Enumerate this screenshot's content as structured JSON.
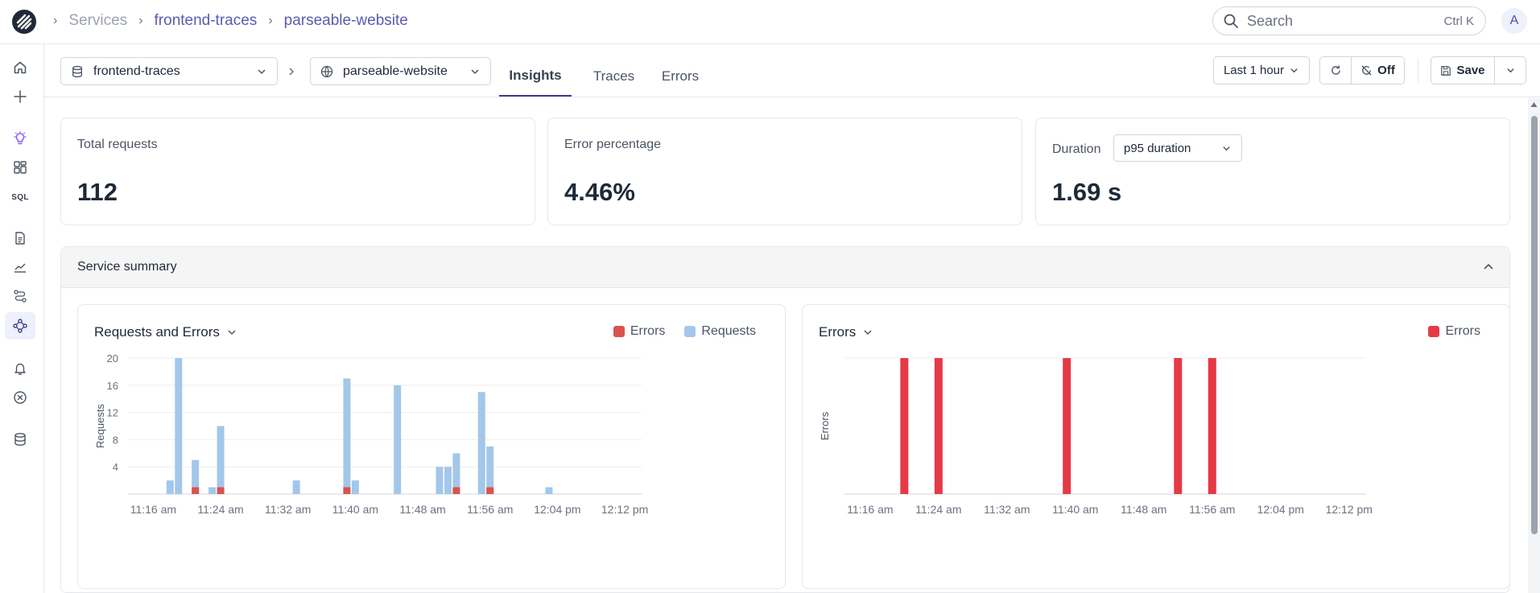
{
  "app": {
    "brand_color": "#3e3f8e",
    "avatar_initial": "A"
  },
  "breadcrumb": {
    "root": "Services",
    "stream": "frontend-traces",
    "service": "parseable-website"
  },
  "search": {
    "placeholder": "Search",
    "shortcut": "Ctrl K"
  },
  "sidebar": {
    "items": [
      {
        "icon": "home-icon"
      },
      {
        "icon": "plus-icon"
      },
      {
        "icon": "lightbulb-icon"
      },
      {
        "icon": "dashboard-icon"
      },
      {
        "icon": "sql-icon",
        "label": "SQL"
      },
      {
        "icon": "document-icon"
      },
      {
        "icon": "chart-line-icon"
      },
      {
        "icon": "flow-icon"
      },
      {
        "icon": "service-map-icon",
        "active": true
      },
      {
        "icon": "bell-icon"
      },
      {
        "icon": "close-circle-icon"
      },
      {
        "icon": "database-icon"
      }
    ]
  },
  "toolbar": {
    "stream_select": "frontend-traces",
    "service_select": "parseable-website",
    "tabs": [
      "Insights",
      "Traces",
      "Errors"
    ],
    "active_tab": "Insights",
    "time_range": "Last 1 hour",
    "auto_refresh": "Off",
    "save_label": "Save"
  },
  "cards": {
    "total_requests": {
      "label": "Total requests",
      "value": "112"
    },
    "error_percentage": {
      "label": "Error percentage",
      "value": "4.46%"
    },
    "duration": {
      "label": "Duration",
      "select": "p95 duration",
      "value": "1.69 s"
    }
  },
  "summary": {
    "title": "Service summary"
  },
  "colors": {
    "requests": "#a3c7ea",
    "errors": "#d9534f",
    "errors_bright": "#e63946"
  },
  "chart_data": [
    {
      "type": "bar",
      "title": "Requests and Errors",
      "ylabel": "Requests",
      "xlabel": "",
      "ylim": [
        0,
        20
      ],
      "yticks": [
        4,
        8,
        12,
        16,
        20
      ],
      "xtick_labels": [
        "11:16 am",
        "11:24 am",
        "11:32 am",
        "11:40 am",
        "11:48 am",
        "11:56 am",
        "12:04 pm",
        "12:12 pm"
      ],
      "legend": [
        "Errors",
        "Requests"
      ],
      "legend_position": "top-right",
      "grid": true,
      "series": [
        {
          "name": "Requests",
          "x": [
            "11:18",
            "11:19",
            "11:21",
            "11:23",
            "11:24",
            "11:33",
            "11:39",
            "11:40",
            "11:45",
            "11:50",
            "11:51",
            "11:52",
            "11:55",
            "11:56",
            "12:03"
          ],
          "values": [
            2,
            20,
            5,
            1,
            10,
            2,
            17,
            2,
            16,
            4,
            4,
            6,
            15,
            7,
            1
          ]
        },
        {
          "name": "Errors",
          "x": [
            "11:21",
            "11:24",
            "11:39",
            "11:52",
            "11:56"
          ],
          "values": [
            1,
            1,
            1,
            1,
            1
          ]
        }
      ]
    },
    {
      "type": "bar",
      "title": "Errors",
      "ylabel": "Errors",
      "xlabel": "",
      "xtick_labels": [
        "11:16 am",
        "11:24 am",
        "11:32 am",
        "11:40 am",
        "11:48 am",
        "11:56 am",
        "12:04 pm",
        "12:12 pm"
      ],
      "legend": [
        "Errors"
      ],
      "legend_position": "top-right",
      "grid": true,
      "series": [
        {
          "name": "Errors",
          "x": [
            "11:20",
            "11:24",
            "11:39",
            "11:52",
            "11:56"
          ],
          "values": [
            1,
            1,
            1,
            1,
            1
          ]
        }
      ]
    }
  ]
}
